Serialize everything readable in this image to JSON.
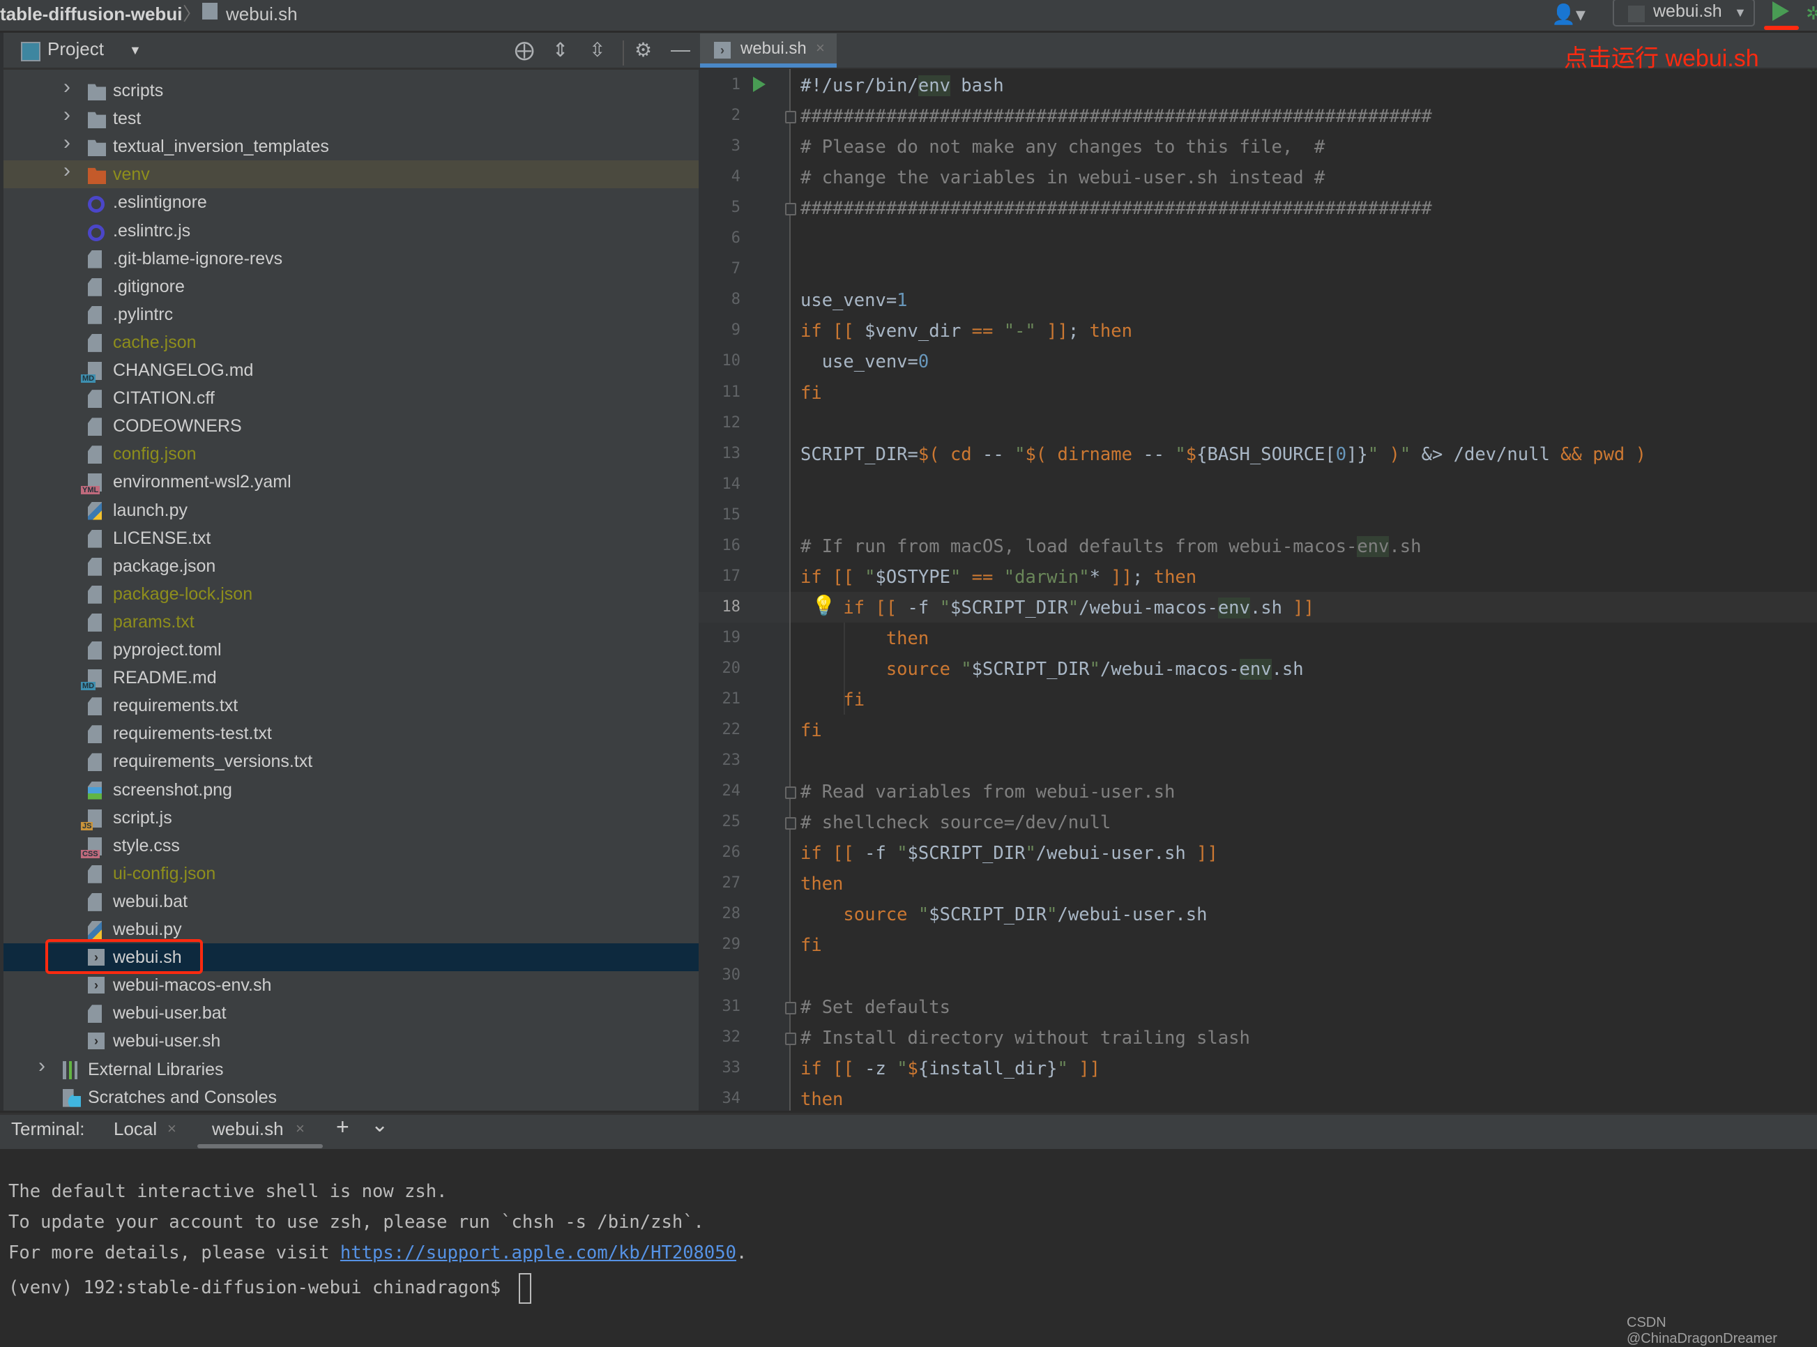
{
  "titlebar": {
    "project": "table-diffusion-webui",
    "separator": "〉",
    "file": "webui.sh",
    "run_config": "webui.sh",
    "run_config_dropdown": "▼",
    "user_icon": "👤▾"
  },
  "project_panel": {
    "title": "Project",
    "dropdown": "▼",
    "tools": {
      "locate": "⨁",
      "expand_all": "⇕",
      "collapse_all": "⇳",
      "settings": "⚙",
      "hide": "—"
    },
    "items": [
      {
        "name": "scripts",
        "type": "folder",
        "expandable": true
      },
      {
        "name": "test",
        "type": "folder-test",
        "expandable": true
      },
      {
        "name": "textual_inversion_templates",
        "type": "folder",
        "expandable": true
      },
      {
        "name": "venv",
        "type": "folder-excluded",
        "expandable": true,
        "ignored": true
      },
      {
        "name": ".eslintignore",
        "type": "eslint"
      },
      {
        "name": ".eslintrc.js",
        "type": "eslint"
      },
      {
        "name": ".git-blame-ignore-revs",
        "type": "text"
      },
      {
        "name": ".gitignore",
        "type": "ignore"
      },
      {
        "name": ".pylintrc",
        "type": "text"
      },
      {
        "name": "cache.json",
        "type": "json",
        "ignored": true
      },
      {
        "name": "CHANGELOG.md",
        "type": "md"
      },
      {
        "name": "CITATION.cff",
        "type": "text"
      },
      {
        "name": "CODEOWNERS",
        "type": "text"
      },
      {
        "name": "config.json",
        "type": "json",
        "ignored": true
      },
      {
        "name": "environment-wsl2.yaml",
        "type": "yml"
      },
      {
        "name": "launch.py",
        "type": "python"
      },
      {
        "name": "LICENSE.txt",
        "type": "text"
      },
      {
        "name": "package.json",
        "type": "json"
      },
      {
        "name": "package-lock.json",
        "type": "json",
        "ignored": true
      },
      {
        "name": "params.txt",
        "type": "text",
        "ignored": true
      },
      {
        "name": "pyproject.toml",
        "type": "toml"
      },
      {
        "name": "README.md",
        "type": "md"
      },
      {
        "name": "requirements.txt",
        "type": "text"
      },
      {
        "name": "requirements-test.txt",
        "type": "text"
      },
      {
        "name": "requirements_versions.txt",
        "type": "text"
      },
      {
        "name": "screenshot.png",
        "type": "image"
      },
      {
        "name": "script.js",
        "type": "js"
      },
      {
        "name": "style.css",
        "type": "css"
      },
      {
        "name": "ui-config.json",
        "type": "json",
        "ignored": true
      },
      {
        "name": "webui.bat",
        "type": "text"
      },
      {
        "name": "webui.py",
        "type": "python"
      },
      {
        "name": "webui.sh",
        "type": "shell",
        "selected": true
      },
      {
        "name": "webui-macos-env.sh",
        "type": "shell"
      },
      {
        "name": "webui-user.bat",
        "type": "text"
      },
      {
        "name": "webui-user.sh",
        "type": "shell"
      },
      {
        "name": "External Libraries",
        "type": "libraries",
        "expandable": true,
        "root": true
      },
      {
        "name": "Scratches and Consoles",
        "type": "scratches",
        "root": true
      }
    ]
  },
  "editor": {
    "tab": {
      "label": "webui.sh",
      "close": "×"
    },
    "annotation": "点击运行 webui.sh",
    "current_line": 18,
    "lines": [
      {
        "n": 1,
        "tokens": [
          [
            "t",
            "#!/usr/bin/"
          ],
          [
            "hl",
            "env"
          ],
          [
            "t",
            " bash"
          ]
        ]
      },
      {
        "n": 2,
        "tokens": [
          [
            "cm",
            "###########################################################"
          ]
        ]
      },
      {
        "n": 3,
        "tokens": [
          [
            "cm",
            "# Please do not make any changes to this file,  #"
          ]
        ]
      },
      {
        "n": 4,
        "tokens": [
          [
            "cm",
            "# change the variables in webui-user.sh instead #"
          ]
        ]
      },
      {
        "n": 5,
        "tokens": [
          [
            "cm",
            "###########################################################"
          ]
        ]
      },
      {
        "n": 6,
        "tokens": []
      },
      {
        "n": 7,
        "tokens": []
      },
      {
        "n": 8,
        "tokens": [
          [
            "t",
            "use_venv="
          ],
          [
            "num",
            "1"
          ]
        ]
      },
      {
        "n": 9,
        "tokens": [
          [
            "kw",
            "if [[ "
          ],
          [
            "t",
            "$venv_dir "
          ],
          [
            "kw",
            "== "
          ],
          [
            "str",
            "\"-\""
          ],
          [
            "kw",
            " ]]"
          ],
          [
            "t",
            "; "
          ],
          [
            "kw",
            "then"
          ]
        ]
      },
      {
        "n": 10,
        "tokens": [
          [
            "t",
            "  use_venv="
          ],
          [
            "num",
            "0"
          ]
        ]
      },
      {
        "n": 11,
        "tokens": [
          [
            "kw",
            "fi"
          ]
        ]
      },
      {
        "n": 12,
        "tokens": []
      },
      {
        "n": 13,
        "tokens": [
          [
            "t",
            "SCRIPT_DIR="
          ],
          [
            "kw",
            "$( cd "
          ],
          [
            "t",
            "-- "
          ],
          [
            "str",
            "\""
          ],
          [
            "kw",
            "$( dirname "
          ],
          [
            "t",
            "-- "
          ],
          [
            "str",
            "\""
          ],
          [
            "kw",
            "$"
          ],
          [
            "t",
            "{BASH_SOURCE["
          ],
          [
            "num",
            "0"
          ],
          [
            "t",
            "]}"
          ],
          [
            "str",
            "\""
          ],
          [
            "kw",
            " )"
          ],
          [
            "str",
            "\""
          ],
          [
            "t",
            " &> /dev/null "
          ],
          [
            "kw",
            "&& pwd )"
          ]
        ]
      },
      {
        "n": 14,
        "tokens": []
      },
      {
        "n": 15,
        "tokens": []
      },
      {
        "n": 16,
        "tokens": [
          [
            "cm",
            "# If run from macOS, load defaults from webui-macos-"
          ],
          [
            "hlcm",
            "env"
          ],
          [
            "cm",
            ".sh"
          ]
        ]
      },
      {
        "n": 17,
        "tokens": [
          [
            "kw",
            "if [[ "
          ],
          [
            "str",
            "\""
          ],
          [
            "t",
            "$OSTYPE"
          ],
          [
            "str",
            "\""
          ],
          [
            "kw",
            " == "
          ],
          [
            "str",
            "\"darwin\""
          ],
          [
            "t",
            "* "
          ],
          [
            "kw",
            "]]"
          ],
          [
            "t",
            "; "
          ],
          [
            "kw",
            "then"
          ]
        ]
      },
      {
        "n": 18,
        "tokens": [
          [
            "t",
            "    "
          ],
          [
            "kw",
            "if [[ "
          ],
          [
            "t",
            "-f "
          ],
          [
            "str",
            "\""
          ],
          [
            "t",
            "$SCRIPT_DIR"
          ],
          [
            "str",
            "\""
          ],
          [
            "t",
            "/webui-macos-"
          ],
          [
            "hl",
            "env"
          ],
          [
            "t",
            ".sh "
          ],
          [
            "kw",
            "]]"
          ]
        ]
      },
      {
        "n": 19,
        "tokens": [
          [
            "t",
            "        "
          ],
          [
            "kw",
            "then"
          ]
        ]
      },
      {
        "n": 20,
        "tokens": [
          [
            "t",
            "        "
          ],
          [
            "kw",
            "source "
          ],
          [
            "str",
            "\""
          ],
          [
            "t",
            "$SCRIPT_DIR"
          ],
          [
            "str",
            "\""
          ],
          [
            "t",
            "/webui-macos-"
          ],
          [
            "hl",
            "env"
          ],
          [
            "t",
            ".sh"
          ]
        ]
      },
      {
        "n": 21,
        "tokens": [
          [
            "t",
            "    "
          ],
          [
            "kw",
            "fi"
          ]
        ]
      },
      {
        "n": 22,
        "tokens": [
          [
            "kw",
            "fi"
          ]
        ]
      },
      {
        "n": 23,
        "tokens": []
      },
      {
        "n": 24,
        "tokens": [
          [
            "cm",
            "# Read variables from webui-user.sh"
          ]
        ]
      },
      {
        "n": 25,
        "tokens": [
          [
            "cm",
            "# shellcheck source=/dev/null"
          ]
        ]
      },
      {
        "n": 26,
        "tokens": [
          [
            "kw",
            "if [[ "
          ],
          [
            "t",
            "-f "
          ],
          [
            "str",
            "\""
          ],
          [
            "t",
            "$SCRIPT_DIR"
          ],
          [
            "str",
            "\""
          ],
          [
            "t",
            "/webui-user.sh "
          ],
          [
            "kw",
            "]]"
          ]
        ]
      },
      {
        "n": 27,
        "tokens": [
          [
            "kw",
            "then"
          ]
        ]
      },
      {
        "n": 28,
        "tokens": [
          [
            "t",
            "    "
          ],
          [
            "kw",
            "source "
          ],
          [
            "str",
            "\""
          ],
          [
            "t",
            "$SCRIPT_DIR"
          ],
          [
            "str",
            "\""
          ],
          [
            "t",
            "/webui-user.sh"
          ]
        ]
      },
      {
        "n": 29,
        "tokens": [
          [
            "kw",
            "fi"
          ]
        ]
      },
      {
        "n": 30,
        "tokens": []
      },
      {
        "n": 31,
        "tokens": [
          [
            "cm",
            "# Set defaults"
          ]
        ]
      },
      {
        "n": 32,
        "tokens": [
          [
            "cm",
            "# Install directory without trailing slash"
          ]
        ]
      },
      {
        "n": 33,
        "tokens": [
          [
            "kw",
            "if [[ "
          ],
          [
            "t",
            "-z "
          ],
          [
            "str",
            "\""
          ],
          [
            "kw",
            "$"
          ],
          [
            "t",
            "{install_dir}"
          ],
          [
            "str",
            "\""
          ],
          [
            "kw",
            " ]]"
          ]
        ]
      },
      {
        "n": 34,
        "tokens": [
          [
            "kw",
            "then"
          ]
        ]
      }
    ]
  },
  "terminal": {
    "label": "Terminal:",
    "tabs": [
      {
        "label": "Local",
        "close": "×"
      },
      {
        "label": "webui.sh",
        "close": "×",
        "active": true
      }
    ],
    "new_tab": "+",
    "more": "⌄",
    "lines": [
      {
        "text": "The default interactive shell is now zsh."
      },
      {
        "text": "To update your account to use zsh, please run `chsh -s /bin/zsh`."
      },
      {
        "text": "For more details, please visit ",
        "link": "https://support.apple.com/kb/HT208050",
        "suffix": "."
      },
      {
        "text": "(venv) 192:stable-diffusion-webui chinadragon$ ",
        "cursor": true
      }
    ]
  },
  "watermark": "CSDN @ChinaDragonDreamer",
  "colors": {
    "keyword": "#cc7832",
    "string": "#6a8759",
    "number": "#6897bb",
    "comment": "#808080",
    "ignored_file": "#8e8e1c",
    "selection": "#0d293e",
    "annotation_red": "#ff2a10",
    "run_green": "#499c54",
    "link": "#5693e6"
  }
}
